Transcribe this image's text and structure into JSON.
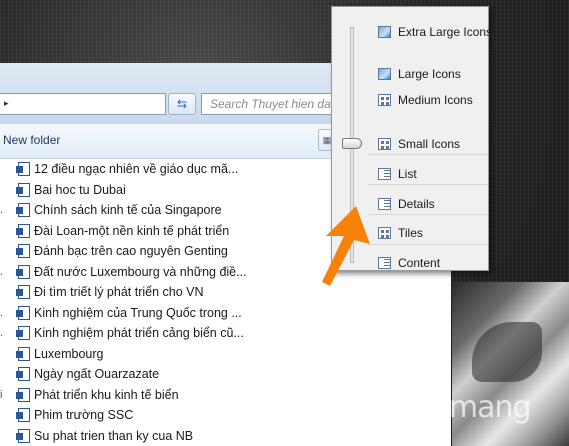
{
  "address": {
    "arrow": "▸",
    "refresh_icon": "⇆"
  },
  "search": {
    "placeholder": "Search Thuyet hien dai"
  },
  "toolbar": {
    "new_folder": "New folder",
    "view_icon": "▦"
  },
  "files": [
    {
      "name": "12 điều ngạc nhiên về giáo dục mã...",
      "mark": ""
    },
    {
      "name": "Bai hoc tu Dubai",
      "mark": ""
    },
    {
      "name": "Chính sách kinh tế của Singapore",
      "mark": "."
    },
    {
      "name": "Đài Loan-một nền kinh tế phát triển",
      "mark": ""
    },
    {
      "name": "Đánh bạc trên cao nguyên Genting",
      "mark": ""
    },
    {
      "name": "Đất nước Luxembourg và những điề...",
      "mark": "."
    },
    {
      "name": "Đi tìm triết lý phát triển cho VN",
      "mark": ""
    },
    {
      "name": "Kinh nghiệm của Trung Quốc trong ...",
      "mark": "."
    },
    {
      "name": "Kinh nghiệm phát triển cảng biển cũ...",
      "mark": "."
    },
    {
      "name": "Luxembourg",
      "mark": ""
    },
    {
      "name": "Ngày ngất Ouarzazate",
      "mark": ""
    },
    {
      "name": "Phát triển khu kinh tế biển",
      "mark": "i"
    },
    {
      "name": "Phim trường SSC",
      "mark": ""
    },
    {
      "name": "Su phat trien than ky cua NB",
      "mark": ""
    }
  ],
  "view_menu": {
    "items": [
      {
        "label": "Extra Large Icons",
        "icon": "picture"
      },
      {
        "label": "Large Icons",
        "icon": "picture"
      },
      {
        "label": "Medium Icons",
        "icon": "grid"
      },
      {
        "label": "Small Icons",
        "icon": "grid"
      },
      {
        "label": "List",
        "icon": "list"
      },
      {
        "label": "Details",
        "icon": "list"
      },
      {
        "label": "Tiles",
        "icon": "grid"
      },
      {
        "label": "Content",
        "icon": "list"
      }
    ],
    "selected": "Small Icons"
  },
  "colors": {
    "arrow": "#f7820a",
    "link_text": "#1e395b"
  },
  "watermark": {
    "text": "uantrimang"
  }
}
